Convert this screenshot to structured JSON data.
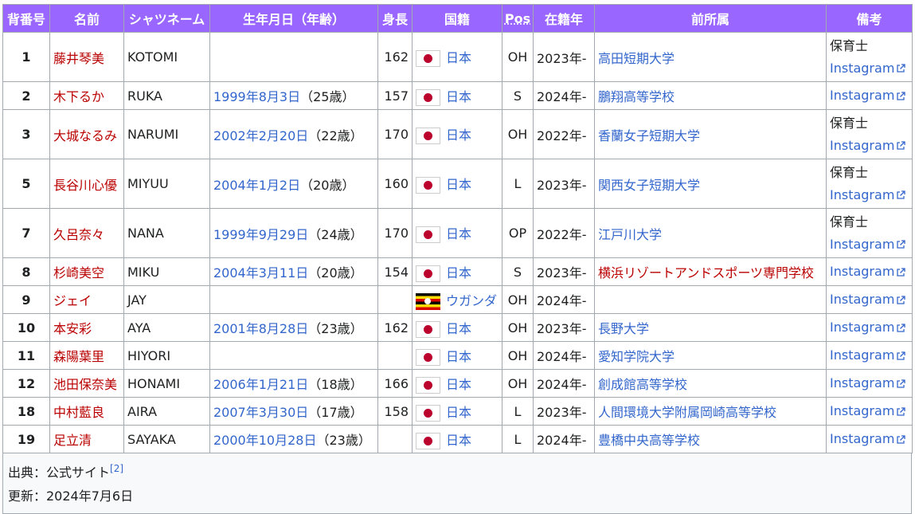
{
  "table": {
    "headers": {
      "number": "背番号",
      "name": "名前",
      "shirt": "シャツネーム",
      "birth": "生年月日（年齢）",
      "height": "身長",
      "nationality": "国籍",
      "pos": "Pos",
      "since": "在籍年",
      "prev": "前所属",
      "note": "備考"
    },
    "header_color": "#9966ff",
    "rows": [
      {
        "number": "1",
        "name": "藤井琴美",
        "shirt": "KOTOMI",
        "birth": "",
        "age": "",
        "height": "162",
        "flag": "jp",
        "country": "日本",
        "pos": "OH",
        "since": "2023年-",
        "prev": "高田短期大学",
        "prev_red": false,
        "note1": "保育士",
        "note2": "Instagram"
      },
      {
        "number": "2",
        "name": "木下るか",
        "shirt": "RUKA",
        "birth": "1999年8月3日",
        "age": "（25歳）",
        "height": "157",
        "flag": "jp",
        "country": "日本",
        "pos": "S",
        "since": "2024年-",
        "prev": "鵬翔高等学校",
        "prev_red": false,
        "note1": "",
        "note2": "Instagram"
      },
      {
        "number": "3",
        "name": "大城なるみ",
        "shirt": "NARUMI",
        "birth": "2002年2月20日",
        "age": "（22歳）",
        "height": "170",
        "flag": "jp",
        "country": "日本",
        "pos": "OH",
        "since": "2022年-",
        "prev": "香蘭女子短期大学",
        "prev_red": false,
        "note1": "保育士",
        "note2": "Instagram"
      },
      {
        "number": "5",
        "name": "長谷川心優",
        "shirt": "MIYUU",
        "birth": "2004年1月2日",
        "age": "（20歳）",
        "height": "160",
        "flag": "jp",
        "country": "日本",
        "pos": "L",
        "since": "2023年-",
        "prev": "関西女子短期大学",
        "prev_red": false,
        "note1": "保育士",
        "note2": "Instagram"
      },
      {
        "number": "7",
        "name": "久呂奈々",
        "shirt": "NANA",
        "birth": "1999年9月29日",
        "age": "（24歳）",
        "height": "170",
        "flag": "jp",
        "country": "日本",
        "pos": "OP",
        "since": "2022年-",
        "prev": "江戸川大学",
        "prev_red": false,
        "note1": "保育士",
        "note2": "Instagram"
      },
      {
        "number": "8",
        "name": "杉崎美空",
        "shirt": "MIKU",
        "birth": "2004年3月11日",
        "age": "（20歳）",
        "height": "154",
        "flag": "jp",
        "country": "日本",
        "pos": "S",
        "since": "2023年-",
        "prev": "横浜リゾートアンドスポーツ専門学校",
        "prev_red": true,
        "note1": "",
        "note2": "Instagram"
      },
      {
        "number": "9",
        "name": "ジェイ",
        "shirt": "JAY",
        "birth": "",
        "age": "",
        "height": "",
        "flag": "ug",
        "country": "ウガンダ",
        "pos": "OH",
        "since": "2024年-",
        "prev": "",
        "prev_red": false,
        "note1": "",
        "note2": "Instagram"
      },
      {
        "number": "10",
        "name": "本安彩",
        "shirt": "AYA",
        "birth": "2001年8月28日",
        "age": "（23歳）",
        "height": "162",
        "flag": "jp",
        "country": "日本",
        "pos": "OH",
        "since": "2023年-",
        "prev": "長野大学",
        "prev_red": false,
        "note1": "",
        "note2": "Instagram"
      },
      {
        "number": "11",
        "name": "森陽葉里",
        "shirt": "HIYORI",
        "birth": "",
        "age": "",
        "height": "",
        "flag": "jp",
        "country": "日本",
        "pos": "OH",
        "since": "2024年-",
        "prev": "愛知学院大学",
        "prev_red": false,
        "note1": "",
        "note2": "Instagram"
      },
      {
        "number": "12",
        "name": "池田保奈美",
        "shirt": "HONAMI",
        "birth": "2006年1月21日",
        "age": "（18歳）",
        "height": "166",
        "flag": "jp",
        "country": "日本",
        "pos": "OH",
        "since": "2024年-",
        "prev": "創成館高等学校",
        "prev_red": false,
        "note1": "",
        "note2": "Instagram"
      },
      {
        "number": "18",
        "name": "中村藍良",
        "shirt": "AIRA",
        "birth": "2007年3月30日",
        "age": "（17歳）",
        "height": "158",
        "flag": "jp",
        "country": "日本",
        "pos": "L",
        "since": "2023年-",
        "prev": "人間環境大学附属岡崎高等学校",
        "prev_red": false,
        "note1": "",
        "note2": "Instagram"
      },
      {
        "number": "19",
        "name": "足立清",
        "shirt": "SAYAKA",
        "birth": "2000年10月28日",
        "age": "（23歳）",
        "height": "",
        "flag": "jp",
        "country": "日本",
        "pos": "L",
        "since": "2024年-",
        "prev": "豊橋中央高等学校",
        "prev_red": false,
        "note1": "",
        "note2": "Instagram"
      }
    ]
  },
  "footer": {
    "source_label": "出典：公式サイト",
    "source_ref": "[2]",
    "updated": "更新：2024年7月6日"
  }
}
